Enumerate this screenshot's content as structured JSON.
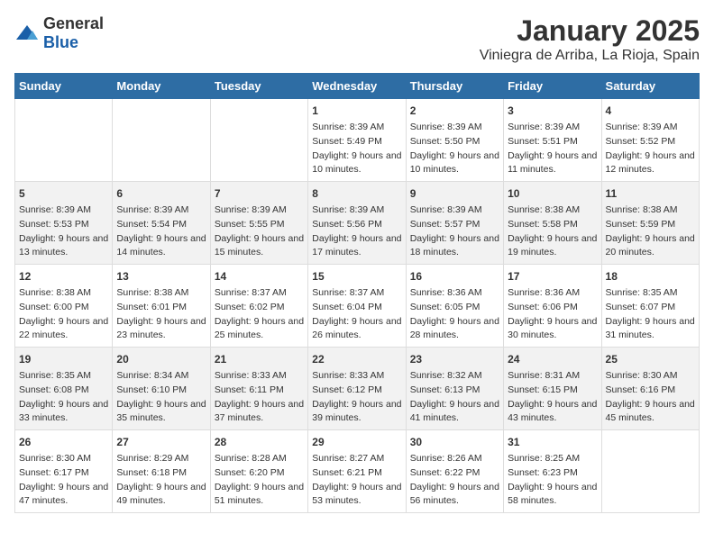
{
  "logo": {
    "general": "General",
    "blue": "Blue"
  },
  "title": "January 2025",
  "subtitle": "Viniegra de Arriba, La Rioja, Spain",
  "days_of_week": [
    "Sunday",
    "Monday",
    "Tuesday",
    "Wednesday",
    "Thursday",
    "Friday",
    "Saturday"
  ],
  "weeks": [
    [
      {
        "day": "",
        "info": ""
      },
      {
        "day": "",
        "info": ""
      },
      {
        "day": "",
        "info": ""
      },
      {
        "day": "1",
        "info": "Sunrise: 8:39 AM\nSunset: 5:49 PM\nDaylight: 9 hours and 10 minutes."
      },
      {
        "day": "2",
        "info": "Sunrise: 8:39 AM\nSunset: 5:50 PM\nDaylight: 9 hours and 10 minutes."
      },
      {
        "day": "3",
        "info": "Sunrise: 8:39 AM\nSunset: 5:51 PM\nDaylight: 9 hours and 11 minutes."
      },
      {
        "day": "4",
        "info": "Sunrise: 8:39 AM\nSunset: 5:52 PM\nDaylight: 9 hours and 12 minutes."
      }
    ],
    [
      {
        "day": "5",
        "info": "Sunrise: 8:39 AM\nSunset: 5:53 PM\nDaylight: 9 hours and 13 minutes."
      },
      {
        "day": "6",
        "info": "Sunrise: 8:39 AM\nSunset: 5:54 PM\nDaylight: 9 hours and 14 minutes."
      },
      {
        "day": "7",
        "info": "Sunrise: 8:39 AM\nSunset: 5:55 PM\nDaylight: 9 hours and 15 minutes."
      },
      {
        "day": "8",
        "info": "Sunrise: 8:39 AM\nSunset: 5:56 PM\nDaylight: 9 hours and 17 minutes."
      },
      {
        "day": "9",
        "info": "Sunrise: 8:39 AM\nSunset: 5:57 PM\nDaylight: 9 hours and 18 minutes."
      },
      {
        "day": "10",
        "info": "Sunrise: 8:38 AM\nSunset: 5:58 PM\nDaylight: 9 hours and 19 minutes."
      },
      {
        "day": "11",
        "info": "Sunrise: 8:38 AM\nSunset: 5:59 PM\nDaylight: 9 hours and 20 minutes."
      }
    ],
    [
      {
        "day": "12",
        "info": "Sunrise: 8:38 AM\nSunset: 6:00 PM\nDaylight: 9 hours and 22 minutes."
      },
      {
        "day": "13",
        "info": "Sunrise: 8:38 AM\nSunset: 6:01 PM\nDaylight: 9 hours and 23 minutes."
      },
      {
        "day": "14",
        "info": "Sunrise: 8:37 AM\nSunset: 6:02 PM\nDaylight: 9 hours and 25 minutes."
      },
      {
        "day": "15",
        "info": "Sunrise: 8:37 AM\nSunset: 6:04 PM\nDaylight: 9 hours and 26 minutes."
      },
      {
        "day": "16",
        "info": "Sunrise: 8:36 AM\nSunset: 6:05 PM\nDaylight: 9 hours and 28 minutes."
      },
      {
        "day": "17",
        "info": "Sunrise: 8:36 AM\nSunset: 6:06 PM\nDaylight: 9 hours and 30 minutes."
      },
      {
        "day": "18",
        "info": "Sunrise: 8:35 AM\nSunset: 6:07 PM\nDaylight: 9 hours and 31 minutes."
      }
    ],
    [
      {
        "day": "19",
        "info": "Sunrise: 8:35 AM\nSunset: 6:08 PM\nDaylight: 9 hours and 33 minutes."
      },
      {
        "day": "20",
        "info": "Sunrise: 8:34 AM\nSunset: 6:10 PM\nDaylight: 9 hours and 35 minutes."
      },
      {
        "day": "21",
        "info": "Sunrise: 8:33 AM\nSunset: 6:11 PM\nDaylight: 9 hours and 37 minutes."
      },
      {
        "day": "22",
        "info": "Sunrise: 8:33 AM\nSunset: 6:12 PM\nDaylight: 9 hours and 39 minutes."
      },
      {
        "day": "23",
        "info": "Sunrise: 8:32 AM\nSunset: 6:13 PM\nDaylight: 9 hours and 41 minutes."
      },
      {
        "day": "24",
        "info": "Sunrise: 8:31 AM\nSunset: 6:15 PM\nDaylight: 9 hours and 43 minutes."
      },
      {
        "day": "25",
        "info": "Sunrise: 8:30 AM\nSunset: 6:16 PM\nDaylight: 9 hours and 45 minutes."
      }
    ],
    [
      {
        "day": "26",
        "info": "Sunrise: 8:30 AM\nSunset: 6:17 PM\nDaylight: 9 hours and 47 minutes."
      },
      {
        "day": "27",
        "info": "Sunrise: 8:29 AM\nSunset: 6:18 PM\nDaylight: 9 hours and 49 minutes."
      },
      {
        "day": "28",
        "info": "Sunrise: 8:28 AM\nSunset: 6:20 PM\nDaylight: 9 hours and 51 minutes."
      },
      {
        "day": "29",
        "info": "Sunrise: 8:27 AM\nSunset: 6:21 PM\nDaylight: 9 hours and 53 minutes."
      },
      {
        "day": "30",
        "info": "Sunrise: 8:26 AM\nSunset: 6:22 PM\nDaylight: 9 hours and 56 minutes."
      },
      {
        "day": "31",
        "info": "Sunrise: 8:25 AM\nSunset: 6:23 PM\nDaylight: 9 hours and 58 minutes."
      },
      {
        "day": "",
        "info": ""
      }
    ]
  ]
}
